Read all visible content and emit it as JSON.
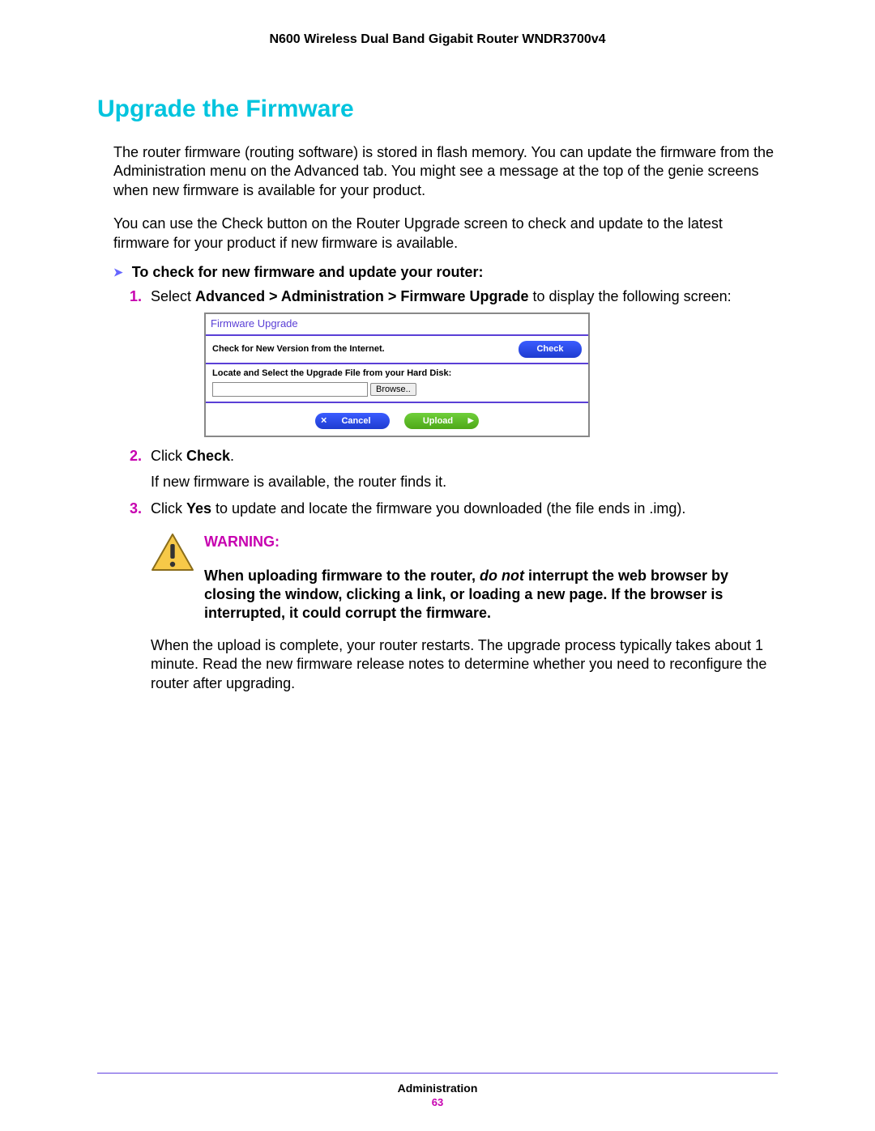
{
  "header": {
    "product_title": "N600 Wireless Dual Band Gigabit Router WNDR3700v4"
  },
  "heading": "Upgrade the Firmware",
  "intro_p1": "The router firmware (routing software) is stored in flash memory. You can update the firmware from the Administration menu on the Advanced tab. You might see a message at the top of the genie screens when new firmware is available for your product.",
  "intro_p2": "You can use the Check button on the Router Upgrade screen to check and update to the latest firmware for your product if new firmware is available.",
  "procedure": {
    "title": "To check for new firmware and update your router:",
    "step1_num": "1.",
    "step1_pre": "Select ",
    "step1_bold": "Advanced > Administration > Firmware Upgrade",
    "step1_post": " to display the following screen:",
    "step2_num": "2.",
    "step2_pre": "Click ",
    "step2_bold": "Check",
    "step2_post": ".",
    "step2_sub": "If new firmware is available, the router finds it.",
    "step3_num": "3.",
    "step3_pre": "Click ",
    "step3_bold": "Yes",
    "step3_post": " to update and locate the firmware you downloaded (the file ends in .img)."
  },
  "ui": {
    "title": "Firmware Upgrade",
    "check_label": "Check for New Version from the Internet.",
    "check_btn": "Check",
    "locate_label": "Locate and Select the Upgrade File from your Hard Disk:",
    "browse_btn": "Browse..",
    "cancel_btn": "Cancel",
    "upload_btn": "Upload"
  },
  "warning": {
    "label": "WARNING:",
    "body_1": "When uploading firmware to the router, ",
    "body_em": "do not",
    "body_2": " interrupt the web browser by closing the window, clicking a link, or loading a new page. If the browser is interrupted, it could corrupt the firmware."
  },
  "closing": "When the upload is complete, your router restarts. The upgrade process typically takes about 1 minute. Read the new firmware release notes to determine whether you need to reconfigure the router after upgrading.",
  "footer": {
    "section": "Administration",
    "page": "63"
  }
}
